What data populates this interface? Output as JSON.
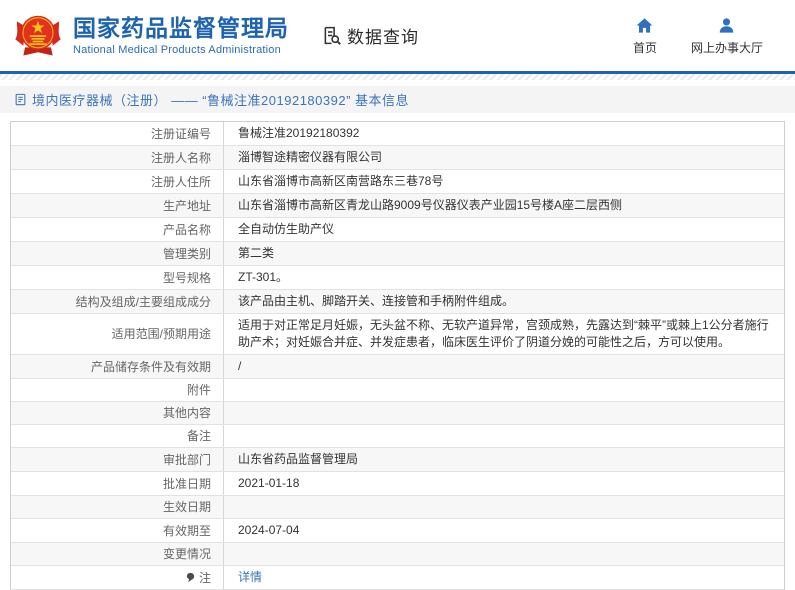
{
  "header": {
    "title": "国家药品监督管理局",
    "subtitle": "National Medical Products Administration",
    "data_query_label": "数据查询",
    "nav": [
      {
        "label": "首页",
        "icon": "home-icon"
      },
      {
        "label": "网上办事大厅",
        "icon": "person-icon"
      }
    ]
  },
  "breadcrumb": {
    "text": "境内医疗器械（注册） —— “鲁械注准20192180392” 基本信息",
    "icon": "document-icon"
  },
  "table": {
    "rows": [
      {
        "label": "注册证编号",
        "value": "鲁械注准20192180392"
      },
      {
        "label": "注册人名称",
        "value": "淄博智途精密仪器有限公司"
      },
      {
        "label": "注册人住所",
        "value": "山东省淄博市高新区南营路东三巷78号"
      },
      {
        "label": "生产地址",
        "value": "山东省淄博市高新区青龙山路9009号仪器仪表产业园15号楼A座二层西侧"
      },
      {
        "label": "产品名称",
        "value": "全自动仿生助产仪"
      },
      {
        "label": "管理类别",
        "value": "第二类"
      },
      {
        "label": "型号规格",
        "value": "ZT-301。"
      },
      {
        "label": "结构及组成/主要组成成分",
        "value": "该产品由主机、脚踏开关、连接管和手柄附件组成。"
      },
      {
        "label": "适用范围/预期用途",
        "value": "适用于对正常足月妊娠，无头盆不称、无软产道异常，宫颈成熟，先露达到“棘平”或棘上1公分者施行助产术；对妊娠合并症、并发症患者，临床医生评价了阴道分娩的可能性之后，方可以使用。"
      },
      {
        "label": "产品储存条件及有效期",
        "value": "/"
      },
      {
        "label": "附件",
        "value": ""
      },
      {
        "label": "其他内容",
        "value": ""
      },
      {
        "label": "备注",
        "value": ""
      },
      {
        "label": "审批部门",
        "value": "山东省药品监督管理局"
      },
      {
        "label": "批准日期",
        "value": "2021-01-18"
      },
      {
        "label": "生效日期",
        "value": ""
      },
      {
        "label": "有效期至",
        "value": "2024-07-04"
      },
      {
        "label": "变更情况",
        "value": ""
      },
      {
        "label": "注",
        "value": "详情",
        "link": true,
        "label_icon": "pin-icon"
      }
    ]
  },
  "colors": {
    "accent_blue": "#1e63b0",
    "link_blue": "#3c74ba",
    "icon_blue": "#2e6fc0",
    "emblem_red": "#d7281e",
    "emblem_gold": "#f7c516",
    "row_alt_bg": "#f7f7f7",
    "crumb_bg": "#f4f4f4"
  }
}
